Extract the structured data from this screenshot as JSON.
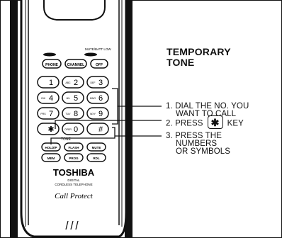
{
  "title_lines": [
    "TEMPORARY",
    "TONE"
  ],
  "steps": {
    "s1_line1": "1. DIAL THE NO. YOU",
    "s1_line2": "WANT TO CALL",
    "s2_before": "2. PRESS",
    "s2_key": "✱",
    "s2_after": "KEY",
    "s3_line1": "3. PRESS THE",
    "s3_line2": "NUMBERS",
    "s3_line3": "OR SYMBOLS"
  },
  "phone": {
    "indicator_label": "MUTE/BATT LOW",
    "function_keys": [
      "PHONE",
      "CHANNEL",
      "OFF"
    ],
    "keypad": [
      {
        "num": "1",
        "sub": ""
      },
      {
        "num": "2",
        "sub": "ABC"
      },
      {
        "num": "3",
        "sub": "DEF"
      },
      {
        "num": "4",
        "sub": "GHI"
      },
      {
        "num": "5",
        "sub": "JKL"
      },
      {
        "num": "6",
        "sub": "MNO"
      },
      {
        "num": "7",
        "sub": "PRS"
      },
      {
        "num": "8",
        "sub": "TUV"
      },
      {
        "num": "9",
        "sub": "WXY"
      },
      {
        "num": "✱",
        "sub": ""
      },
      {
        "num": "0",
        "sub": "OPER"
      },
      {
        "num": "#",
        "sub": ""
      }
    ],
    "tone_label": "TONE",
    "bottom_keys_row1": [
      "HOLD/P",
      "FLASH",
      "MUTE"
    ],
    "bottom_keys_row2": [
      "MEM",
      "PROG",
      "RDL"
    ],
    "brand": "TOSHIBA",
    "model_line1": "DIGITAL",
    "model_line2": "CORDLESS TELEPHONE",
    "logo_script": "Call Protect"
  }
}
